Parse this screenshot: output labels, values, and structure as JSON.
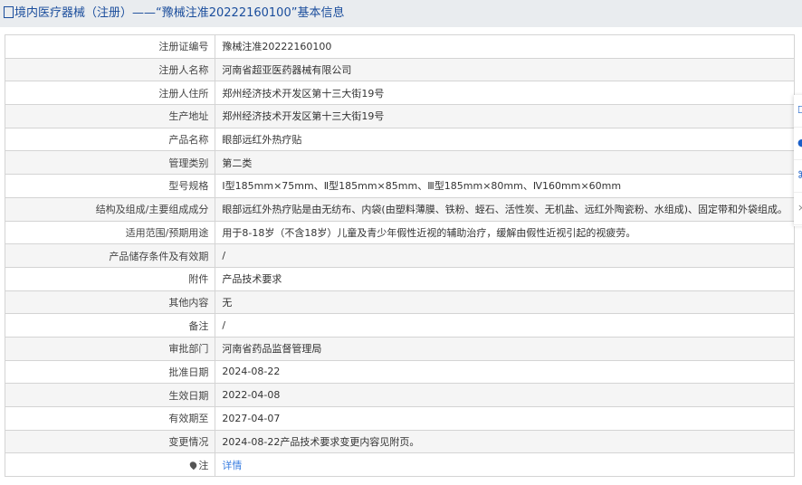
{
  "header": {
    "title": "境内医疗器械（注册）——“豫械注准20222160100”基本信息"
  },
  "rows": [
    {
      "label": "注册证编号",
      "value": "豫械注准20222160100"
    },
    {
      "label": "注册人名称",
      "value": "河南省超亚医药器械有限公司"
    },
    {
      "label": "注册人住所",
      "value": "郑州经济技术开发区第十三大街19号"
    },
    {
      "label": "生产地址",
      "value": "郑州经济技术开发区第十三大街19号"
    },
    {
      "label": "产品名称",
      "value": "眼部远红外热疗贴"
    },
    {
      "label": "管理类别",
      "value": "第二类"
    },
    {
      "label": "型号规格",
      "value": "Ⅰ型185mm×75mm、Ⅱ型185mm×85mm、Ⅲ型185mm×80mm、Ⅳ160mm×60mm"
    },
    {
      "label": "结构及组成/主要组成成分",
      "value": "眼部远红外热疗贴是由无纺布、内袋(由塑料薄膜、铁粉、蛭石、活性炭、无机盐、远红外陶瓷粉、水组成)、固定带和外袋组成。"
    },
    {
      "label": "适用范围/预期用途",
      "value": "用于8-18岁（不含18岁）儿童及青少年假性近视的辅助治疗，缓解由假性近视引起的视疲劳。"
    },
    {
      "label": "产品储存条件及有效期",
      "value": "/"
    },
    {
      "label": "附件",
      "value": "产品技术要求"
    },
    {
      "label": "其他内容",
      "value": "无"
    },
    {
      "label": "备注",
      "value": "/"
    },
    {
      "label": "审批部门",
      "value": "河南省药品监督管理局"
    },
    {
      "label": "批准日期",
      "value": "2024-08-22"
    },
    {
      "label": "生效日期",
      "value": "2022-04-08"
    },
    {
      "label": "有效期至",
      "value": "2027-04-07"
    },
    {
      "label": "变更情况",
      "value": "2024-08-22产品技术要求变更内容见附页。"
    },
    {
      "label": "注",
      "value": "详情"
    }
  ],
  "side_icons": [
    "document-icon",
    "circle-icon",
    "share-icon",
    "close-icon"
  ]
}
